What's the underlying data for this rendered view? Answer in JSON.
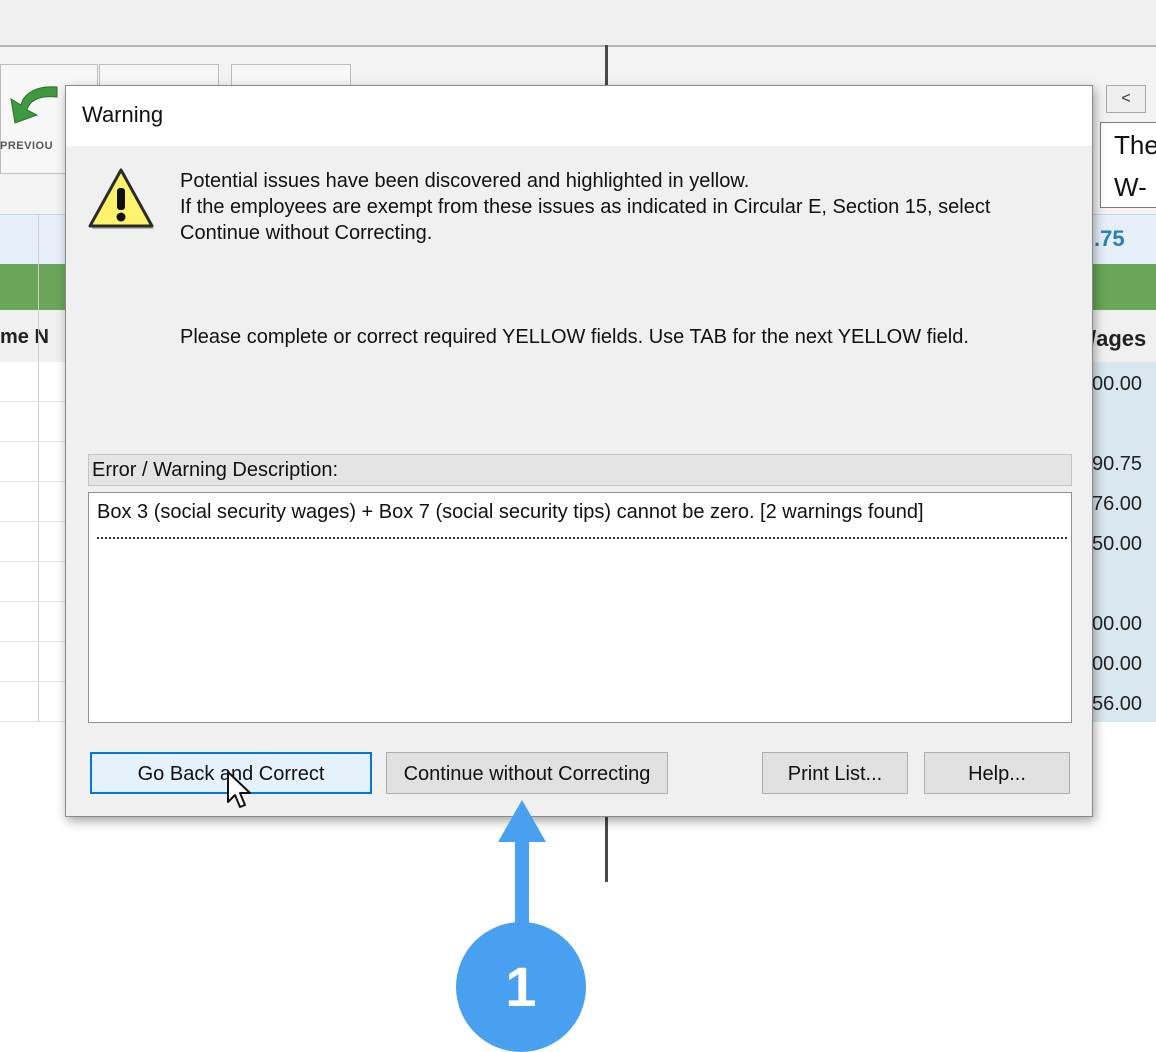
{
  "background": {
    "toolbar_prev_label": "PREVIOU",
    "left_grid_header": "me  N",
    "nav_button": "<",
    "right_text_line1": "The",
    "right_text_line2": "W-",
    "right_total": ".75",
    "right_grid_header": "/ages",
    "right_values": [
      "00.00",
      "",
      "90.75",
      "76.00",
      "50.00",
      "",
      "00.00",
      "00.00",
      "56.00"
    ]
  },
  "dialog": {
    "title": "Warning",
    "message_line1": "Potential issues have been discovered and highlighted in yellow.",
    "message_line2": "If the employees are exempt from these issues as indicated in Circular E, Section 15, select",
    "message_line3": "Continue without Correcting.",
    "instruction": "Please complete or correct required YELLOW fields. Use TAB for the next YELLOW field.",
    "description_header": "Error / Warning Description:",
    "descriptions": [
      "Box 3 (social security wages) + Box 7 (social security tips) cannot be zero. [2 warnings found]"
    ],
    "buttons": {
      "go_back": "Go Back and Correct",
      "continue": "Continue without Correcting",
      "print": "Print List...",
      "help": "Help..."
    }
  },
  "annotation": {
    "step_number": "1",
    "color": "#4aa0f0"
  }
}
